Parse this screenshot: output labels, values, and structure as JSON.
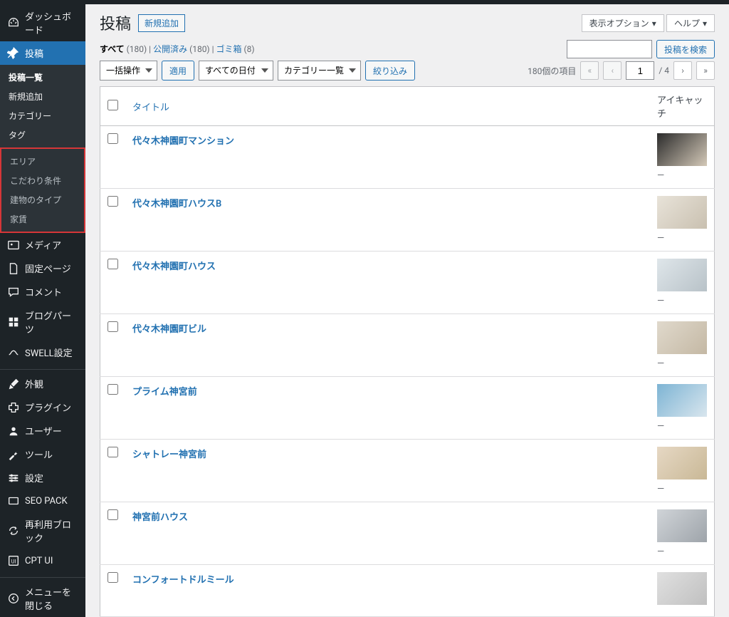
{
  "screen": {
    "options_label": "表示オプション",
    "help_label": "ヘルプ"
  },
  "page": {
    "heading": "投稿",
    "add_new": "新規追加"
  },
  "sidebar": {
    "dashboard": "ダッシュボード",
    "posts": "投稿",
    "posts_sub": {
      "list": "投稿一覧",
      "new": "新規追加",
      "category": "カテゴリー",
      "tag": "タグ",
      "area": "エリア",
      "kodawari": "こだわり条件",
      "building_type": "建物のタイプ",
      "yachin": "家賃"
    },
    "media": "メディア",
    "pages": "固定ページ",
    "comments": "コメント",
    "blogparts": "ブログパーツ",
    "swell": "SWELL設定",
    "appearance": "外観",
    "plugins": "プラグイン",
    "users": "ユーザー",
    "tools": "ツール",
    "settings": "設定",
    "seopack": "SEO PACK",
    "reusable": "再利用ブロック",
    "cptui": "CPT UI",
    "collapse": "メニューを閉じる"
  },
  "filters": {
    "all": "すべて",
    "all_count": "(180)",
    "published": "公開済み",
    "published_count": "(180)",
    "trash": "ゴミ箱",
    "trash_count": "(8)"
  },
  "search": {
    "button": "投稿を検索"
  },
  "bulk": {
    "action_label": "一括操作",
    "apply": "適用",
    "all_dates": "すべての日付",
    "category_list": "カテゴリー一覧",
    "filter": "絞り込み"
  },
  "pagination": {
    "items_label": "180個の項目",
    "current": "1",
    "total": "/ 4"
  },
  "table": {
    "title_col": "タイトル",
    "thumb_col": "アイキャッチ",
    "rows": [
      {
        "title": "代々木神園町マンション",
        "dash": "—"
      },
      {
        "title": "代々木神園町ハウスB",
        "dash": "—"
      },
      {
        "title": "代々木神園町ハウス",
        "dash": "—"
      },
      {
        "title": "代々木神園町ビル",
        "dash": "—"
      },
      {
        "title": "プライム神宮前",
        "dash": "—"
      },
      {
        "title": "シャトレー神宮前",
        "dash": "—"
      },
      {
        "title": "神宮前ハウス",
        "dash": "—"
      },
      {
        "title": "コンフォートドルミール",
        "dash": ""
      }
    ]
  }
}
